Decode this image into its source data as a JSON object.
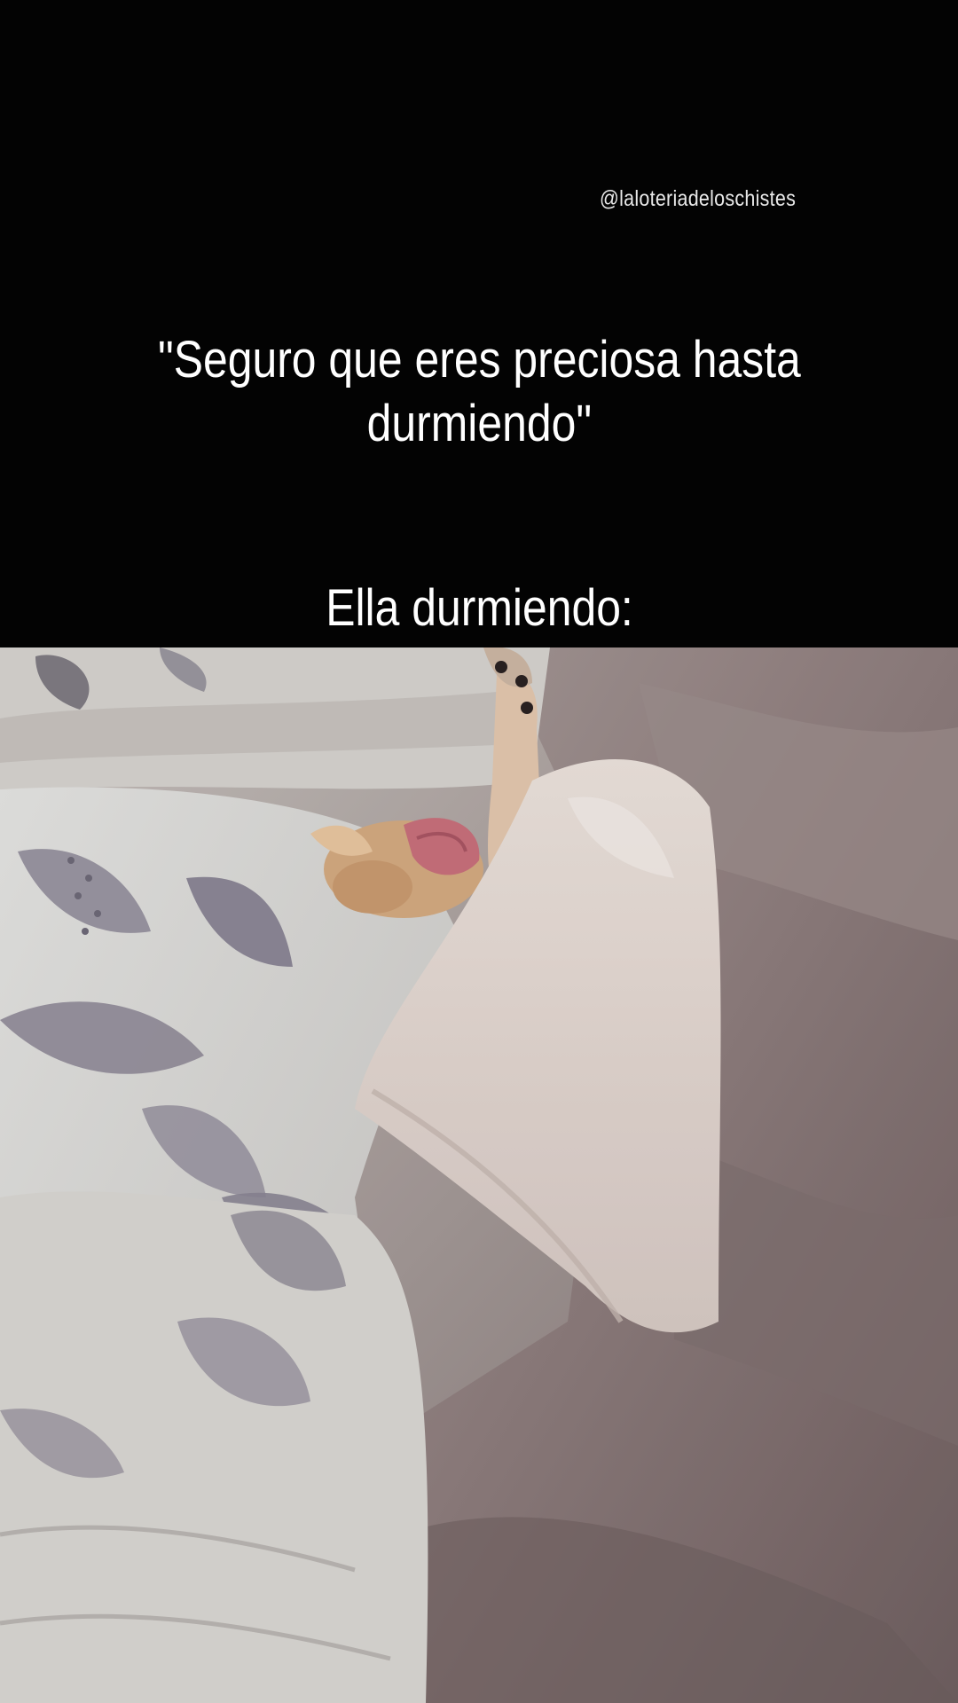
{
  "caption": {
    "watermark": "@laloteriadeloschistes",
    "quote_line1": "\"Seguro que eres preciosa hasta",
    "quote_line2": "durmiendo\"",
    "punchline": "Ella durmiendo:"
  },
  "photo": {
    "subject": "small dog sleeping under blankets with tongue out",
    "palette": {
      "blanket_light": "#dcdbd7",
      "blanket_pattern": "#8f8b98",
      "duvet_mauve": "#8b7a7a",
      "dog_fur": "#d2a77e",
      "tongue": "#c56f78"
    }
  }
}
